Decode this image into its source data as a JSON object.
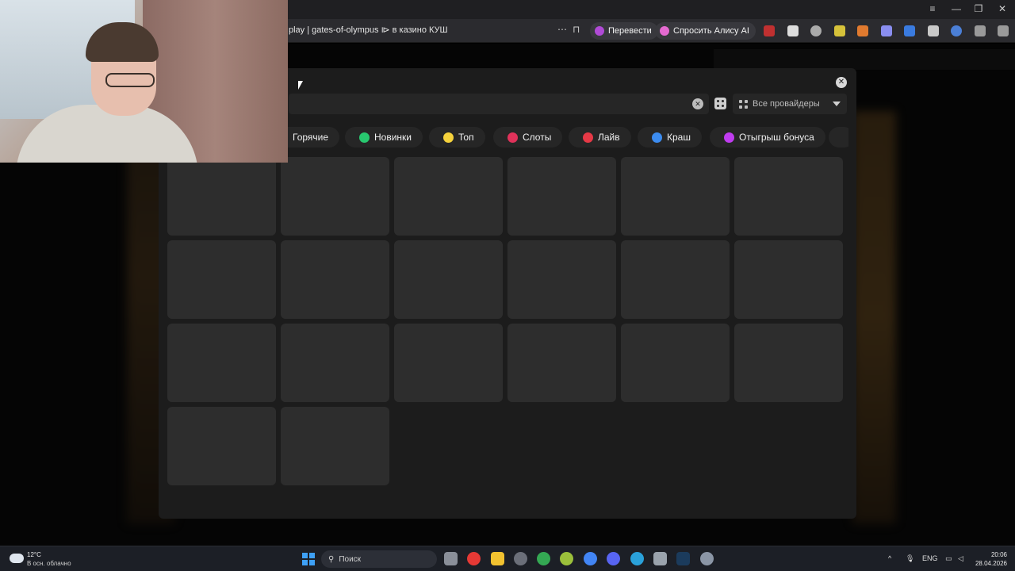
{
  "browser": {
    "url_text": "play | gates-of-olympus ⧐ в казино КУШ",
    "translate_label": "Перевести",
    "alice_label": "Спросить Алису AI"
  },
  "modal": {
    "providers_label": "Все провайдеры",
    "categories": [
      {
        "label": "Горячие",
        "icon": "fire-icon",
        "color": "#ff7a2f"
      },
      {
        "label": "Новинки",
        "icon": "plus-circle-icon",
        "color": "#28c76f"
      },
      {
        "label": "Топ",
        "icon": "star-icon",
        "color": "#f5d23c"
      },
      {
        "label": "Слоты",
        "icon": "cherry-icon",
        "color": "#e0325a"
      },
      {
        "label": "Лайв",
        "icon": "live-icon",
        "color": "#e63946"
      },
      {
        "label": "Краш",
        "icon": "plane-icon",
        "color": "#3c8cf0"
      },
      {
        "label": "Отыгрыш бонуса",
        "icon": "gift-icon",
        "color": "#c03cf0"
      }
    ],
    "tiles_count": 20
  },
  "taskbar": {
    "weather_temp": "12°C",
    "weather_desc": "В осн. облачно",
    "search_placeholder": "Поиск",
    "lang": "ENG",
    "time": "20:06",
    "date": "28.04.2026"
  }
}
